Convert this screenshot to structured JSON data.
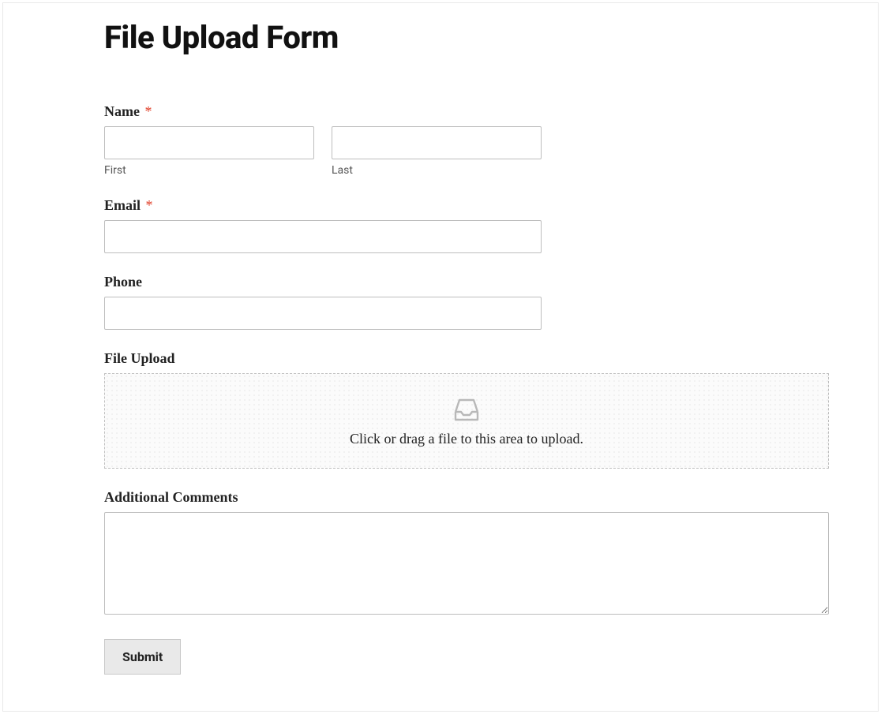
{
  "form": {
    "title": "File Upload Form",
    "name_label": "Name",
    "name_first_sublabel": "First",
    "name_last_sublabel": "Last",
    "email_label": "Email",
    "phone_label": "Phone",
    "file_upload_label": "File Upload",
    "file_upload_hint": "Click or drag a file to this area to upload.",
    "comments_label": "Additional Comments",
    "submit_label": "Submit",
    "required_marker": "*"
  }
}
